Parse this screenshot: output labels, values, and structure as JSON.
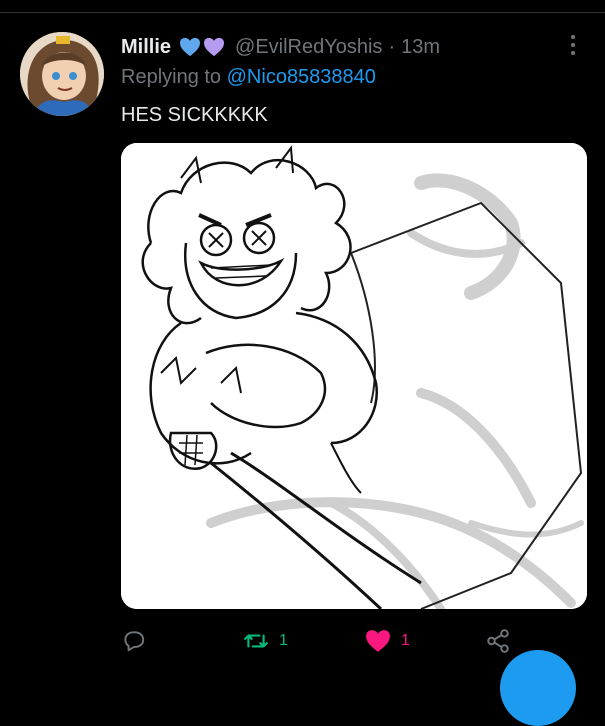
{
  "tweet": {
    "display_name": "Millie",
    "handle": "@EvilRedYoshis",
    "separator": "·",
    "time": "13m",
    "replying_prefix": "Replying to",
    "replying_to": "@Nico85838840",
    "text": "HES SICKKKKK"
  },
  "badges": [
    "blue-heart-icon",
    "purple-heart-icon"
  ],
  "actions": {
    "reply": {
      "icon": "speech-bubble-icon",
      "count": ""
    },
    "retweet": {
      "icon": "retweet-icon",
      "count": "1"
    },
    "like": {
      "icon": "heart-icon",
      "count": "1"
    },
    "share": {
      "icon": "share-icon",
      "count": ""
    }
  },
  "colors": {
    "background": "#000000",
    "text": "#e7e9ea",
    "muted": "#71767b",
    "link": "#1d9bf0",
    "retweet": "#00ba7c",
    "like": "#f91880",
    "heart_blue": "#5fa8f0",
    "heart_purple": "#b59cf0"
  }
}
